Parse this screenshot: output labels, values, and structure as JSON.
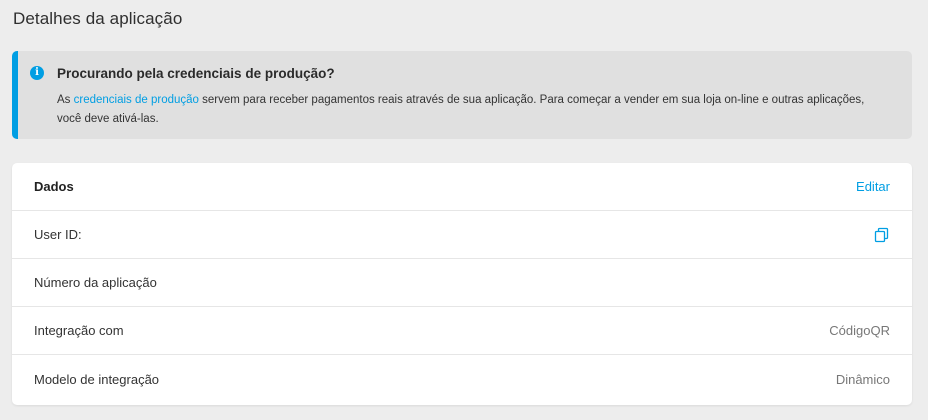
{
  "page": {
    "title": "Detalhes da aplicação"
  },
  "notice": {
    "icon": "info-icon",
    "icon_glyph": "i",
    "title": "Procurando pela credenciais de produção?",
    "body_prefix": "As ",
    "link_text": "credenciais de produção",
    "body_suffix": " servem para receber pagamentos reais através de sua aplicação. Para começar a vender em sua loja on-line e outras aplicações, você deve ativá-las.",
    "accent_color": "#009ee3"
  },
  "details": {
    "header_label": "Dados",
    "edit_label": "Editar",
    "rows": [
      {
        "label": "User ID:",
        "value": "",
        "icon": "copy-icon"
      },
      {
        "label": "Número da aplicação",
        "value": ""
      },
      {
        "label": "Integração com",
        "value": "CódigoQR"
      },
      {
        "label": "Modelo de integração",
        "value": "Dinâmico"
      }
    ]
  }
}
